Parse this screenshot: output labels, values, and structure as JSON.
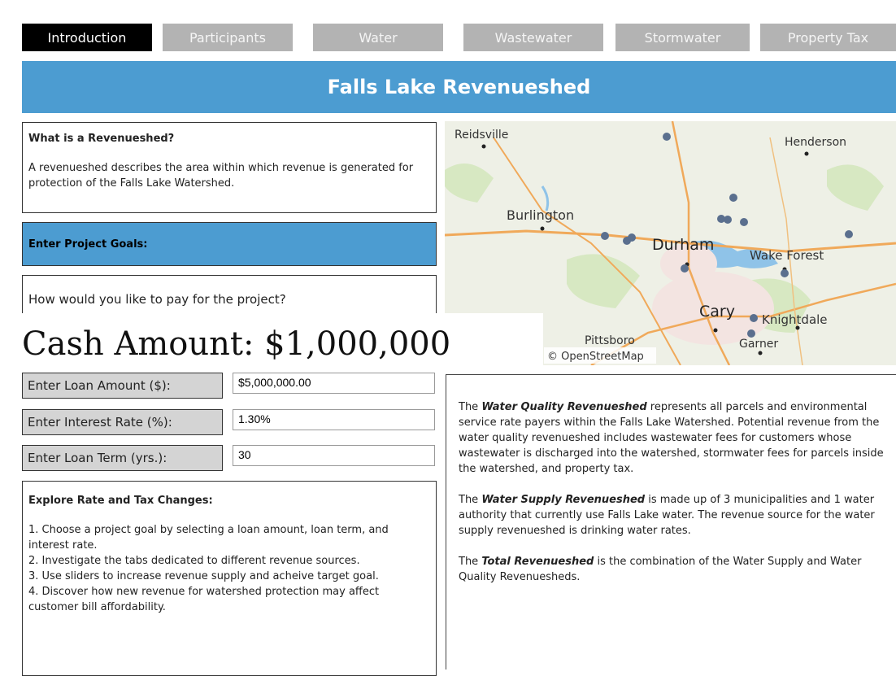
{
  "tabs": [
    {
      "label": "Introduction",
      "active": true
    },
    {
      "label": "Participants",
      "active": false
    },
    {
      "label": "Water",
      "active": false
    },
    {
      "label": "Wastewater",
      "active": false
    },
    {
      "label": "Stormwater",
      "active": false
    },
    {
      "label": "Property Tax",
      "active": false
    }
  ],
  "banner": {
    "title": "Falls Lake Revenueshed"
  },
  "what_box": {
    "title": "What is a Revenueshed?",
    "text": "A revenueshed describes the area within which revenue is generated for protection of the Falls Lake Watershed."
  },
  "goals": {
    "label": "Enter Project Goals:"
  },
  "pay_box": {
    "question": "How would you like to pay for the project?"
  },
  "cash_overlay": {
    "text": "Cash Amount: $1,000,000"
  },
  "loan": {
    "amount_label": "Enter Loan Amount ($):",
    "amount_value": "$5,000,000.00",
    "rate_label": "Enter Interest Rate (%):",
    "rate_value": "1.30%",
    "term_label": "Enter Loan Term (yrs.):",
    "term_value": "30"
  },
  "explore": {
    "title": "Explore Rate and Tax Changes:",
    "items": [
      "1. Choose a project goal by selecting a loan amount, loan term, and interest rate.",
      "2. Investigate the tabs dedicated to different revenue sources.",
      "3. Use sliders to increase revenue supply and acheive target goal.",
      "4. Discover how new revenue for watershed protection may affect customer bill affordability."
    ]
  },
  "map": {
    "cities": [
      "Reidsville",
      "Henderson",
      "Burlington",
      "Durham",
      "Wake Forest",
      "Cary",
      "Knightdale",
      "Pittsboro",
      "Garner"
    ],
    "attribution": "© OpenStreetMap",
    "colors": {
      "land": "#eef0e6",
      "green": "#cfe3b5",
      "water": "#8fc3e8",
      "road": "#f0a95a",
      "marker": "#5a6f8e"
    }
  },
  "right": {
    "p1_pre": "The ",
    "p1_bold": "Water Quality Revenueshed",
    "p1_post": " represents all parcels and environmental service rate payers within the Falls Lake Watershed. Potential revenue from the water quality revenueshed includes wastewater fees for customers whose wastewater is discharged into the watershed, stormwater fees for parcels inside the watershed, and property tax.",
    "p2_pre": "The ",
    "p2_bold": "Water Supply Revenueshed",
    "p2_post": " is made up of 3 municipalities and 1 water authority that currently use Falls Lake water.  The revenue source for the water supply revenueshed is drinking water rates.",
    "p3_pre": "The ",
    "p3_bold": "Total Revenueshed",
    "p3_post": " is the combination of the Water Supply and Water Quality Revenuesheds."
  }
}
